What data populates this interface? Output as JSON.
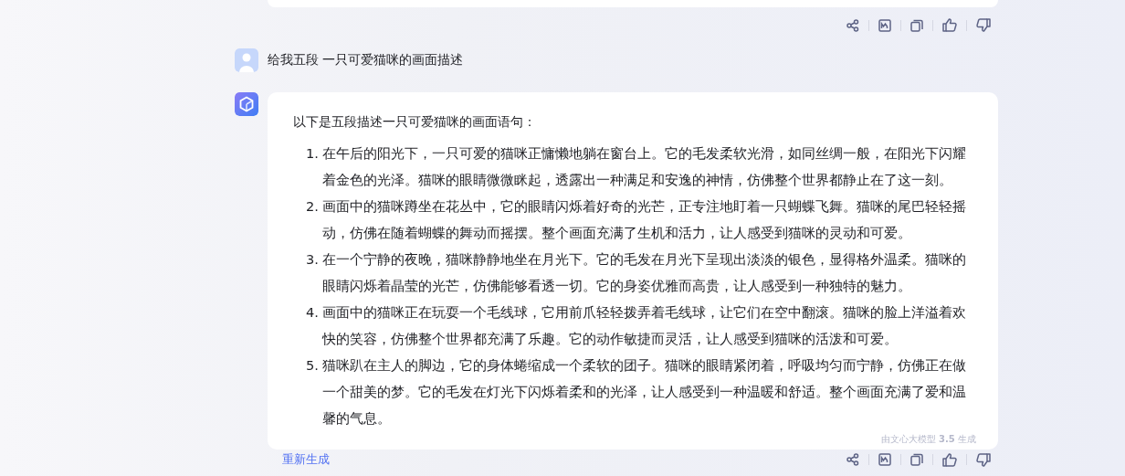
{
  "user_message": {
    "text": "给我五段 一只可爱猫咪的画面描述"
  },
  "reply": {
    "intro": "以下是五段描述一只可爱猫咪的画面语句：",
    "items": [
      {
        "number": "1.",
        "text": "在午后的阳光下，一只可爱的猫咪正慵懒地躺在窗台上。它的毛发柔软光滑，如同丝绸一般，在阳光下闪耀着金色的光泽。猫咪的眼睛微微眯起，透露出一种满足和安逸的神情，仿佛整个世界都静止在了这一刻。"
      },
      {
        "number": "2.",
        "text": "画面中的猫咪蹲坐在花丛中，它的眼睛闪烁着好奇的光芒，正专注地盯着一只蝴蝶飞舞。猫咪的尾巴轻轻摇动，仿佛在随着蝴蝶的舞动而摇摆。整个画面充满了生机和活力，让人感受到猫咪的灵动和可爱。"
      },
      {
        "number": "3.",
        "text": "在一个宁静的夜晚，猫咪静静地坐在月光下。它的毛发在月光下呈现出淡淡的银色，显得格外温柔。猫咪的眼睛闪烁着晶莹的光芒，仿佛能够看透一切。它的身姿优雅而高贵，让人感受到一种独特的魅力。"
      },
      {
        "number": "4.",
        "text": "画面中的猫咪正在玩耍一个毛线球，它用前爪轻轻拨弄着毛线球，让它们在空中翻滚。猫咪的脸上洋溢着欢快的笑容，仿佛整个世界都充满了乐趣。它的动作敏捷而灵活，让人感受到猫咪的活泼和可爱。"
      },
      {
        "number": "5.",
        "text": "猫咪趴在主人的脚边，它的身体蜷缩成一个柔软的团子。猫咪的眼睛紧闭着，呼吸均匀而宁静，仿佛正在做一个甜美的梦。它的毛发在灯光下闪烁着柔和的光泽，让人感受到一种温暖和舒适。整个画面充满了爱和温馨的气息。"
      }
    ],
    "footer": "由文心大模型 **3.5** 生成",
    "regenerate": "重新生成"
  }
}
